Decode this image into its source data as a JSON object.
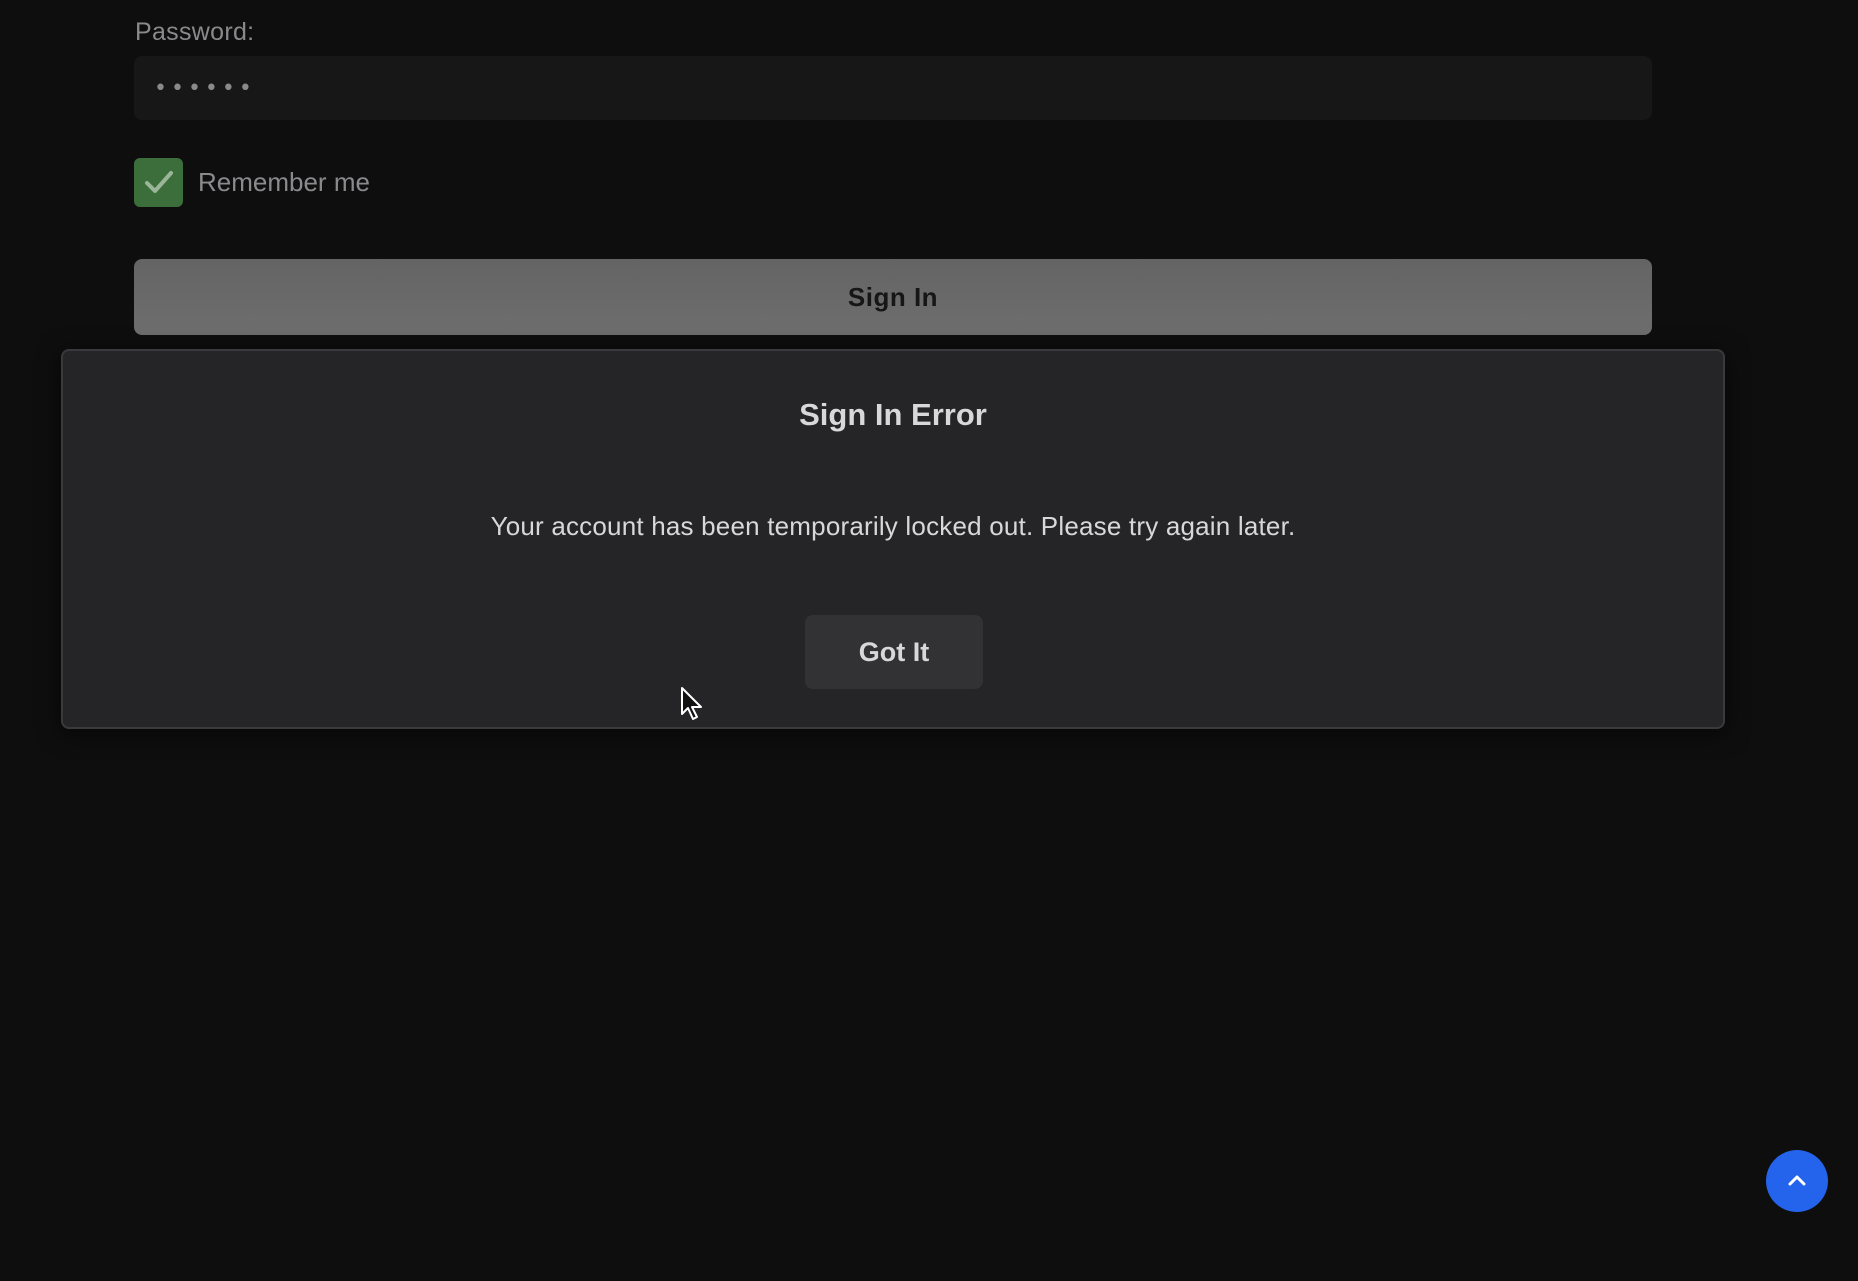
{
  "form": {
    "password_label": "Password:",
    "password_value": "••••••",
    "remember_label": "Remember me",
    "remember_checked": true,
    "signin_label": "Sign In"
  },
  "modal": {
    "title": "Sign In Error",
    "message": "Your account has been temporarily locked out. Please try again later.",
    "button_label": "Got It"
  },
  "icons": {
    "checkbox": "checkmark-icon",
    "scroll_top": "chevron-up-icon",
    "cursor": "mouse-pointer-icon"
  },
  "colors": {
    "background": "#0e0e0f",
    "checkbox": "#3b6e3a",
    "modal": "#252527",
    "accent": "#2463eb"
  }
}
